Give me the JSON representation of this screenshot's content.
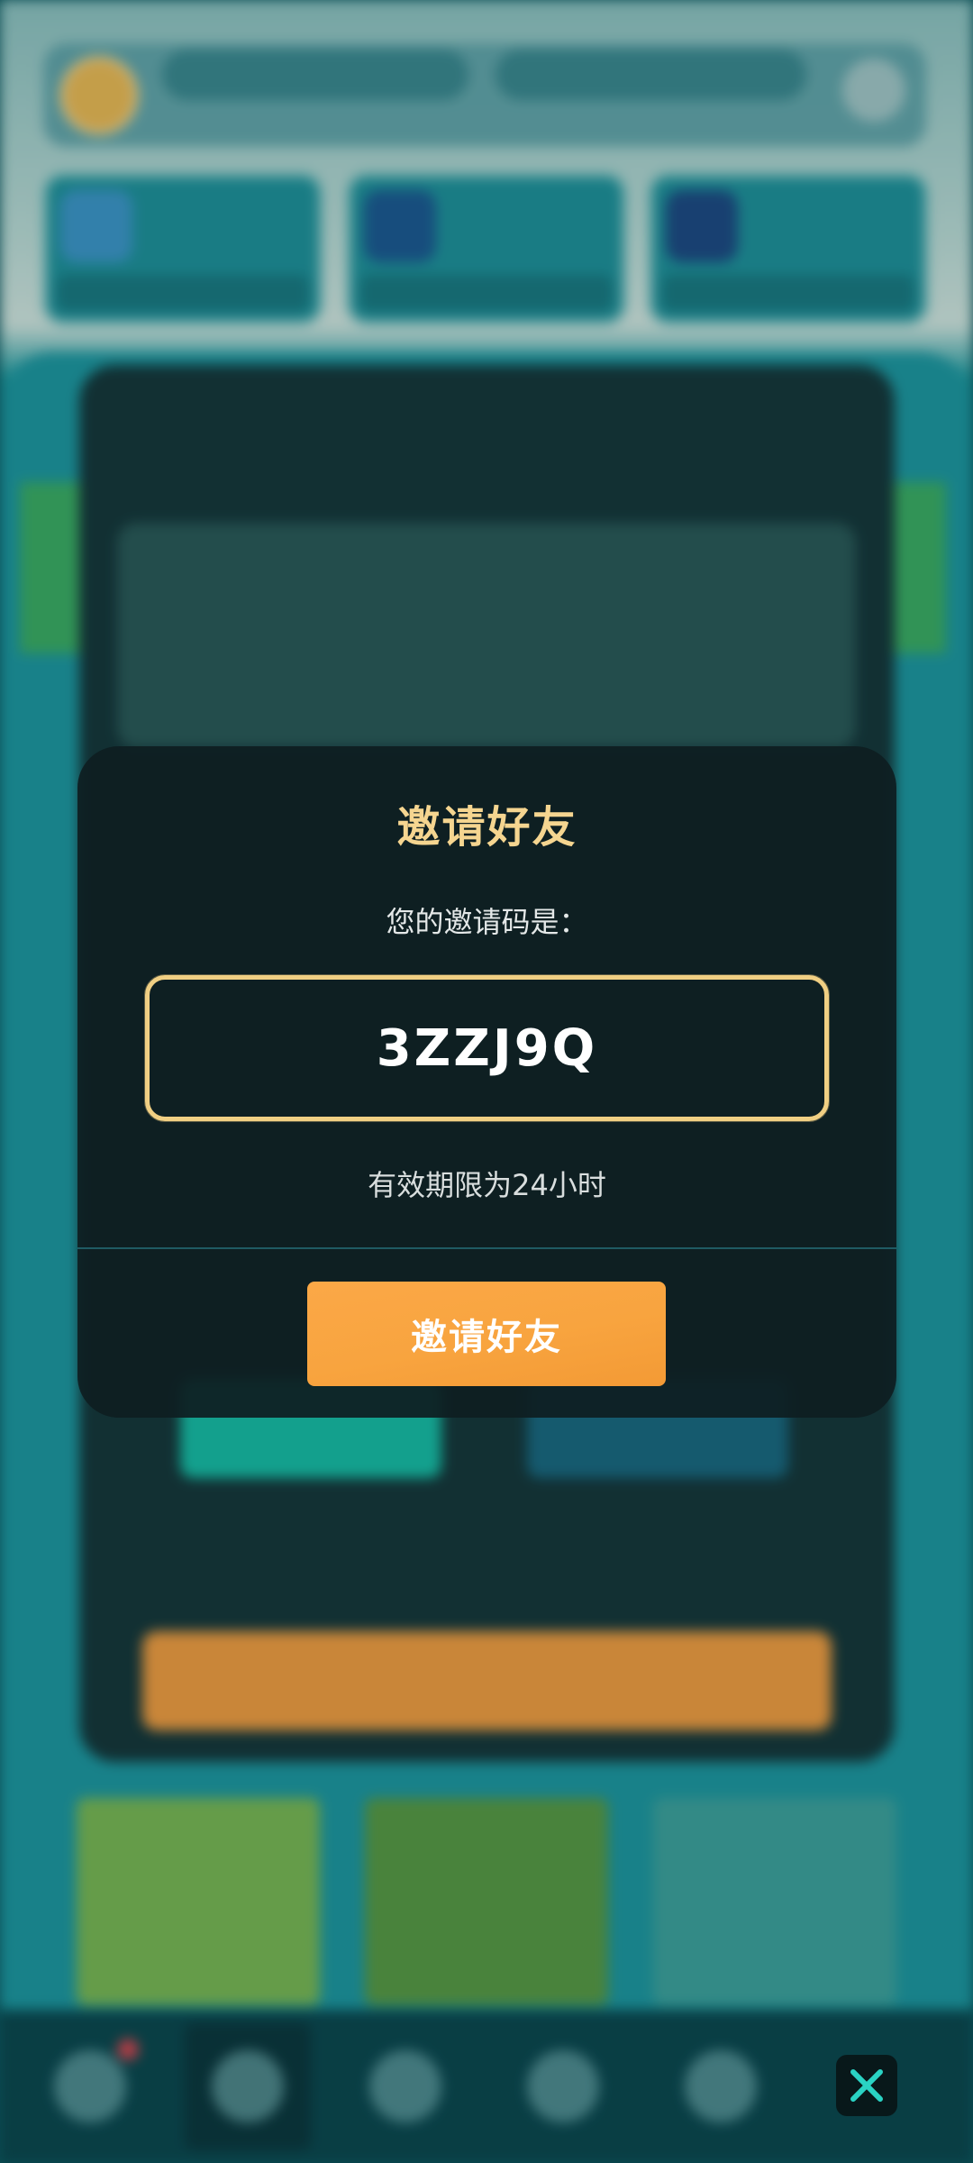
{
  "dialog": {
    "title": "邀请好友",
    "subtitle": "您的邀请码是：",
    "invite_code": "3ZZJ9Q",
    "validity": "有效期限为24小时",
    "invite_button_label": "邀请好友"
  },
  "close_button": {
    "icon": "close-icon"
  },
  "colors": {
    "title": "#f5d590",
    "code_border": "#f0cf83",
    "button": "#f8a43f",
    "dialog_bg": "#0e1e21",
    "close_icon": "#2ad3c4"
  }
}
